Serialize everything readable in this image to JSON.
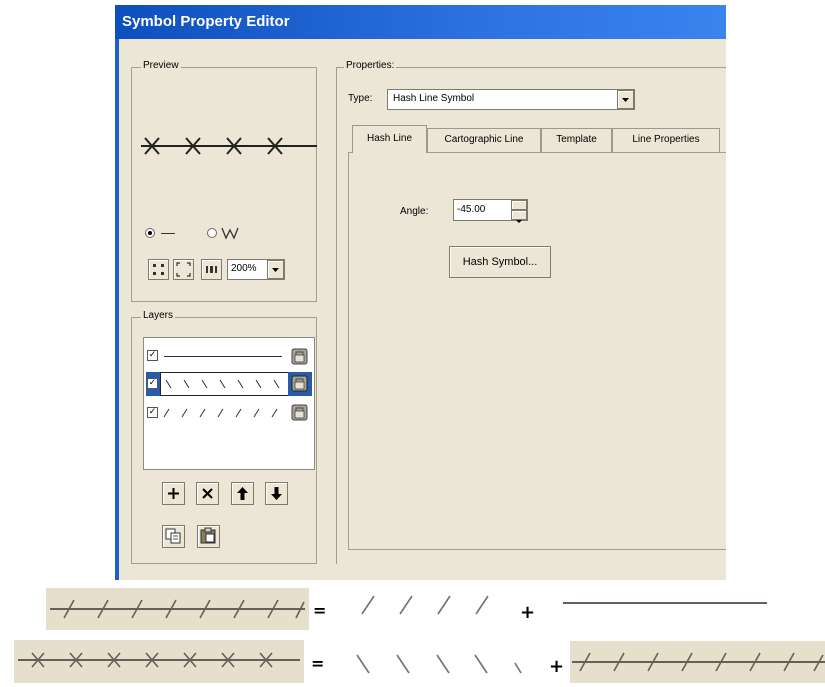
{
  "window": {
    "title": "Symbol Property Editor"
  },
  "preview": {
    "group_label": "Preview",
    "marks": "✕ ✕ ✕ ✕",
    "zoom_value": "200%"
  },
  "properties": {
    "group_label": "Properties:",
    "type_label": "Type:",
    "type_value": "Hash Line Symbol",
    "tabs": [
      {
        "label": "Hash Line"
      },
      {
        "label": "Cartographic Line"
      },
      {
        "label": "Template"
      },
      {
        "label": "Line Properties"
      }
    ],
    "angle_label": "Angle:",
    "angle_value": "-45.00",
    "hash_symbol_button": "Hash Symbol..."
  },
  "layers": {
    "group_label": "Layers",
    "rows": [
      {
        "checked": true,
        "pattern": "solid-line"
      },
      {
        "checked": true,
        "pattern": "backslash-hashes",
        "selected": true
      },
      {
        "checked": true,
        "pattern": "slash-hashes"
      }
    ]
  },
  "equations": {
    "row1": {
      "equals": "=",
      "plus": "+"
    },
    "row2": {
      "equals": "=",
      "plus": "+"
    }
  },
  "colors": {
    "titlebar": "#0c4fbd",
    "dialog_bg": "#ece6d6",
    "selection": "#2a5ba8"
  },
  "icons": [
    "zoom-in-icon",
    "zoom-out-icon",
    "fixed-zoom-icon",
    "add-layer-icon",
    "delete-layer-icon",
    "move-up-icon",
    "move-down-icon",
    "copy-icon",
    "paste-icon",
    "lock-icon"
  ]
}
